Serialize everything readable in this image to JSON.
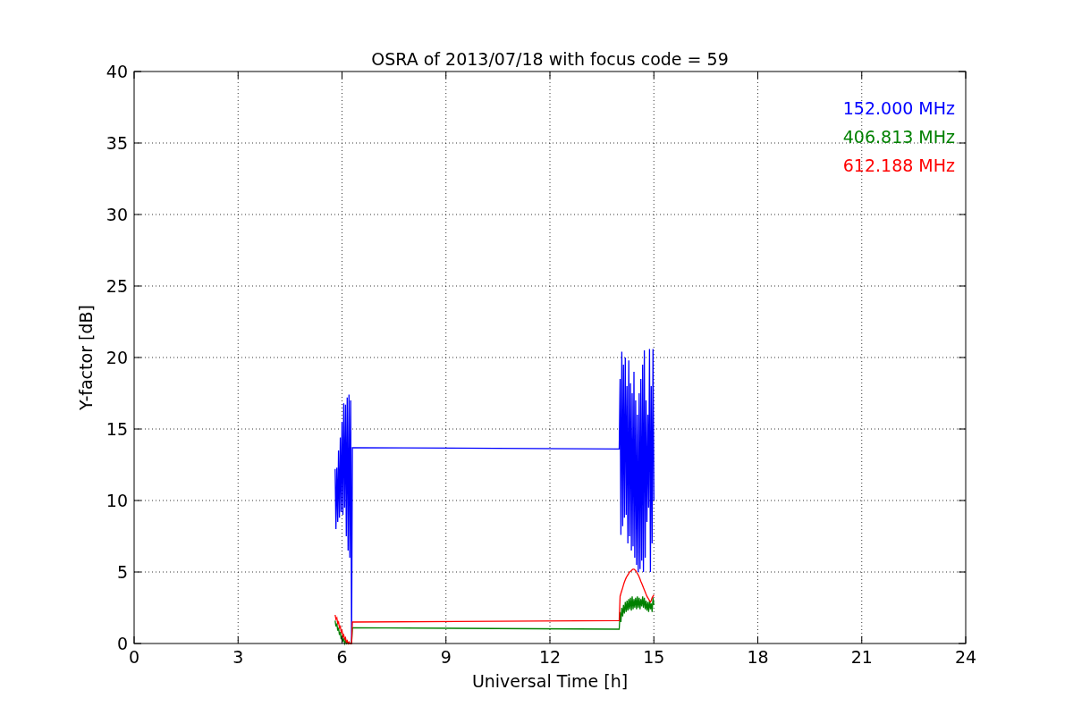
{
  "chart_data": {
    "type": "line",
    "title": "OSRA of 2013/07/18 with focus code = 59",
    "xlabel": "Universal Time [h]",
    "ylabel": "Y-factor [dB]",
    "xlim": [
      0,
      24
    ],
    "ylim": [
      0,
      40
    ],
    "xticks": [
      0,
      3,
      6,
      9,
      12,
      15,
      18,
      21,
      24
    ],
    "yticks": [
      0,
      5,
      10,
      15,
      20,
      25,
      30,
      35,
      40
    ],
    "grid": true,
    "x": [
      5.8,
      5.825,
      5.85,
      5.875,
      5.9,
      5.925,
      5.95,
      5.975,
      6.0,
      6.025,
      6.05,
      6.075,
      6.1,
      6.125,
      6.15,
      6.175,
      6.2,
      6.225,
      6.25,
      6.275,
      6.3,
      14.0,
      14.025,
      14.05,
      14.075,
      14.1,
      14.125,
      14.15,
      14.175,
      14.2,
      14.225,
      14.25,
      14.275,
      14.3,
      14.325,
      14.35,
      14.375,
      14.4,
      14.425,
      14.45,
      14.475,
      14.5,
      14.525,
      14.55,
      14.575,
      14.6,
      14.625,
      14.65,
      14.675,
      14.7,
      14.725,
      14.75,
      14.775,
      14.8,
      14.825,
      14.85,
      14.875,
      14.9,
      14.925,
      14.95,
      14.975,
      15.0
    ],
    "series": [
      {
        "name": "152.000 MHz",
        "color": "#0000ff",
        "values": [
          12.2,
          8.0,
          12.3,
          8.5,
          13.5,
          8.8,
          14.4,
          9.2,
          15.5,
          9.0,
          16.8,
          9.5,
          16.7,
          7.5,
          17.2,
          6.5,
          17.4,
          6.0,
          17.0,
          0.0,
          13.7,
          13.6,
          18.5,
          7.6,
          20.4,
          8.2,
          19.5,
          8.8,
          20.0,
          9.0,
          18.0,
          7.0,
          19.8,
          7.5,
          18.2,
          6.5,
          17.5,
          6.8,
          19.0,
          6.0,
          17.0,
          5.5,
          16.0,
          5.0,
          17.5,
          5.2,
          18.5,
          5.8,
          19.5,
          5.0,
          20.5,
          6.0,
          17.0,
          8.5,
          16.0,
          9.5,
          20.6,
          5.0,
          18.0,
          7.0,
          20.6,
          10.0
        ]
      },
      {
        "name": "406.813 MHz",
        "color": "#008000",
        "values": [
          1.6,
          1.2,
          1.4,
          0.9,
          1.1,
          0.6,
          0.8,
          0.3,
          0.5,
          0.2,
          0.3,
          0.0,
          0.2,
          0.0,
          0.1,
          0.0,
          0.1,
          0.0,
          0.0,
          0.0,
          1.1,
          1.0,
          2.2,
          1.5,
          2.5,
          1.9,
          2.7,
          2.1,
          2.9,
          2.2,
          3.0,
          2.3,
          3.1,
          2.4,
          3.2,
          2.3,
          3.3,
          2.4,
          3.1,
          2.5,
          3.2,
          2.4,
          3.3,
          2.5,
          3.2,
          2.4,
          3.1,
          2.6,
          3.3,
          2.5,
          3.2,
          2.4,
          3.0,
          2.3,
          2.9,
          2.2,
          3.0,
          2.4,
          2.8,
          2.2,
          3.2,
          2.7
        ]
      },
      {
        "name": "612.188 MHz",
        "color": "#ff0000",
        "values": [
          2.0,
          1.7,
          1.8,
          1.4,
          1.5,
          1.1,
          1.2,
          0.8,
          0.9,
          0.5,
          0.6,
          0.3,
          0.4,
          0.1,
          0.2,
          0.0,
          0.1,
          0.0,
          0.0,
          0.0,
          1.5,
          1.6,
          3.3,
          3.5,
          3.7,
          3.9,
          4.1,
          4.3,
          4.45,
          4.6,
          4.7,
          4.8,
          4.9,
          5.0,
          5.05,
          5.1,
          5.15,
          5.2,
          5.2,
          5.15,
          5.1,
          5.0,
          4.9,
          4.8,
          4.65,
          4.5,
          4.35,
          4.2,
          4.05,
          3.9,
          3.75,
          3.6,
          3.45,
          3.3,
          3.2,
          3.1,
          3.0,
          2.9,
          3.0,
          3.2,
          3.3,
          3.4
        ]
      }
    ]
  }
}
